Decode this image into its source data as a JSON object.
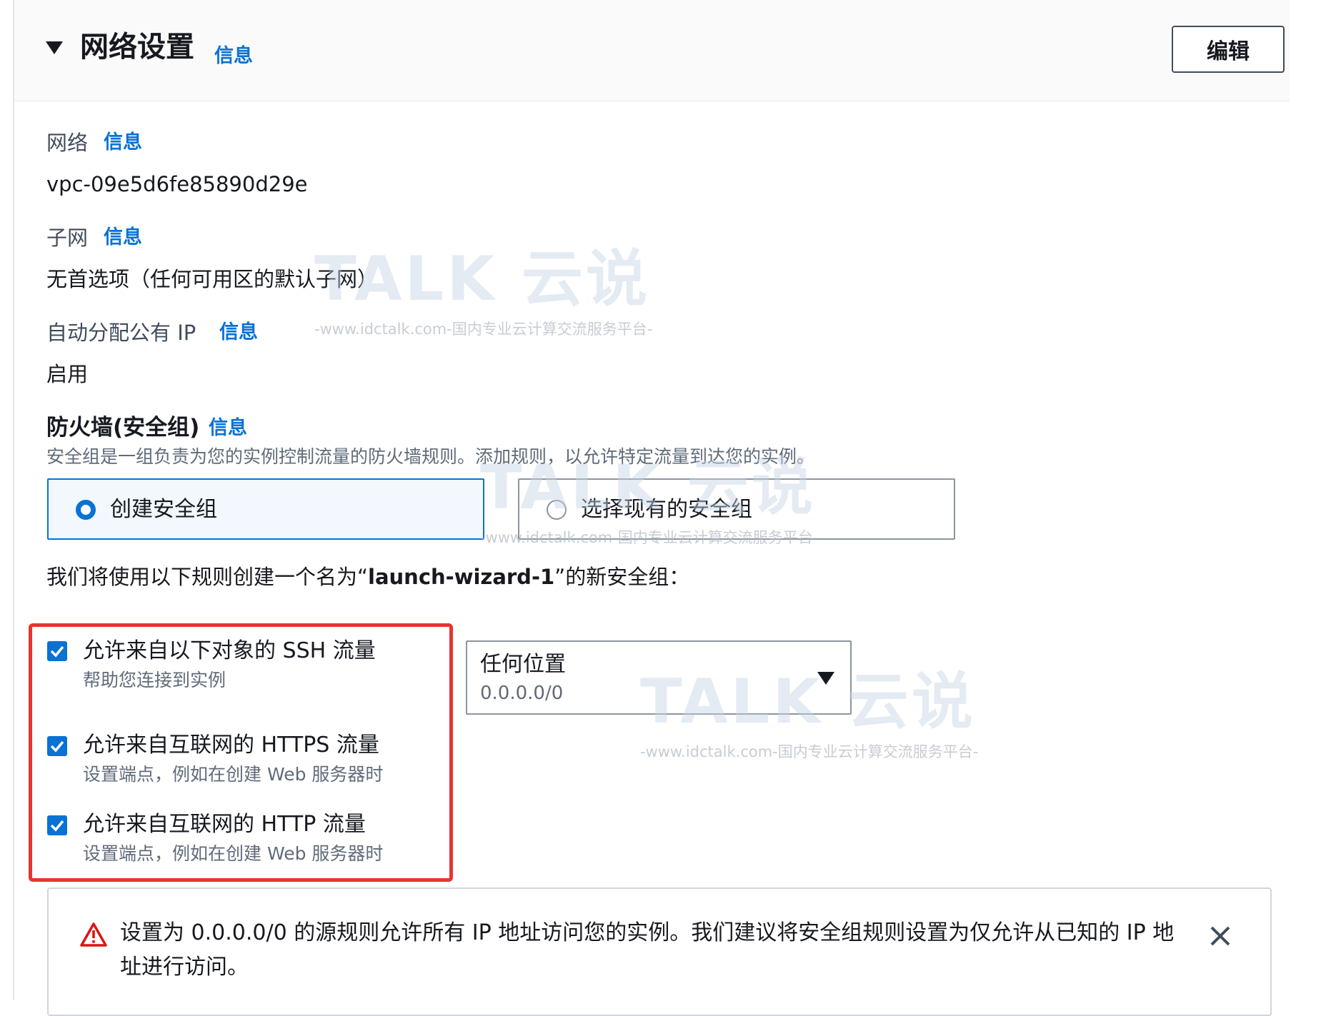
{
  "header": {
    "title": "网络设置",
    "info_link": "信息",
    "edit_button": "编辑"
  },
  "network": {
    "label": "网络",
    "info_link": "信息",
    "value": "vpc-09e5d6fe85890d29e"
  },
  "subnet": {
    "label": "子网",
    "info_link": "信息",
    "value": "无首选项（任何可用区的默认子网）"
  },
  "public_ip": {
    "label": "自动分配公有 IP",
    "info_link": "信息",
    "value": "启用"
  },
  "firewall": {
    "title": "防火墙(安全组)",
    "info_link": "信息",
    "description": "安全组是一组负责为您的实例控制流量的防火墙规则。添加规则，以允许特定流量到达您的实例。",
    "options": [
      {
        "label": "创建安全组",
        "selected": true
      },
      {
        "label": "选择现有的安全组",
        "selected": false
      }
    ],
    "intro_prefix": "我们将使用以下规则创建一个名为“",
    "group_name": "launch-wizard-1",
    "intro_suffix": "”的新安全组："
  },
  "rules": [
    {
      "label": "允许来自以下对象的 SSH 流量",
      "description": "帮助您连接到实例",
      "checked": true
    },
    {
      "label": "允许来自互联网的 HTTPS 流量",
      "description": "设置端点，例如在创建 Web 服务器时",
      "checked": true
    },
    {
      "label": "允许来自互联网的 HTTP 流量",
      "description": "设置端点，例如在创建 Web 服务器时",
      "checked": true
    }
  ],
  "ssh_source": {
    "value": "任何位置",
    "sub": "0.0.0.0/0"
  },
  "alert": {
    "text": "设置为 0.0.0.0/0 的源规则允许所有 IP 地址访问您的实例。我们建议将安全组规则设置为仅允许从已知的 IP 地址进行访问。"
  },
  "watermark": {
    "brand": "TALK 云说",
    "sub": "-www.idctalk.com-国内专业云计算交流服务平台-"
  },
  "colors": {
    "link": "#0972d3",
    "highlight": "#e8342e",
    "warning": "#d91515"
  }
}
